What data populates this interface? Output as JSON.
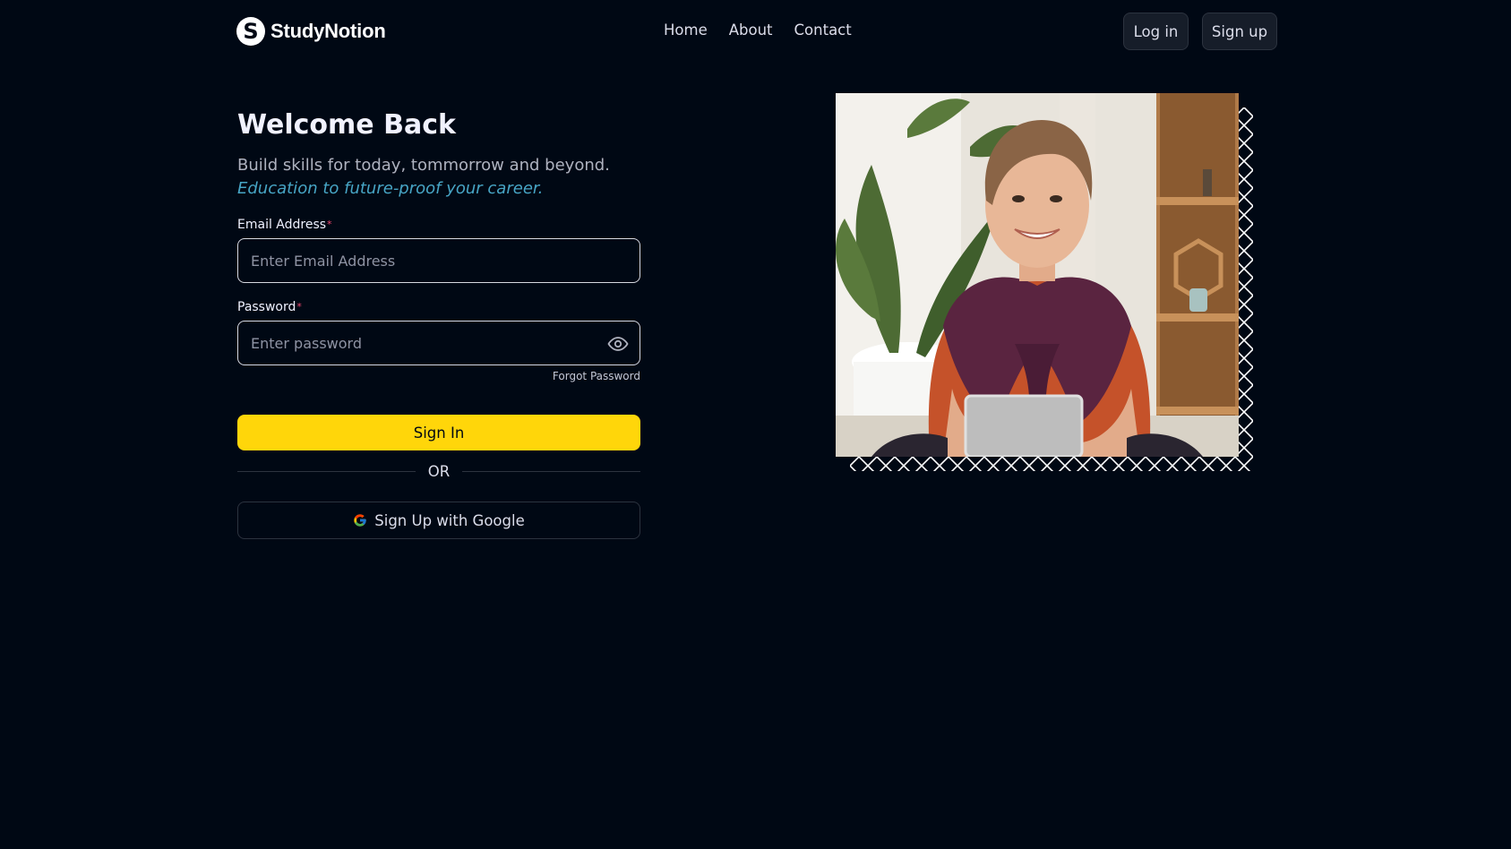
{
  "navbar": {
    "logo_mark": "S",
    "logo_text": "StudyNotion",
    "links": [
      {
        "label": "Home"
      },
      {
        "label": "About"
      },
      {
        "label": "Contact"
      }
    ],
    "login_label": "Log in",
    "signup_label": "Sign up"
  },
  "login": {
    "title": "Welcome Back",
    "subtitle": "Build skills for today, tommorrow and beyond.",
    "subtitle_emphasis": "Education to future-proof your career.",
    "email_label": "Email Address",
    "email_placeholder": "Enter Email Address",
    "email_value": "",
    "password_label": "Password",
    "password_placeholder": "Enter password",
    "password_value": "",
    "required_mark": "*",
    "forgot_label": "Forgot Password",
    "signin_label": "Sign In",
    "or_label": "OR",
    "google_label": "Sign Up with Google"
  },
  "colors": {
    "background": "#000814",
    "accent_yellow": "#ffd60a",
    "accent_blue": "#47a5c5",
    "required_red": "#ef476f"
  },
  "icons": {
    "logo": "studynotion-logo-icon",
    "password_toggle": "eye-icon",
    "google": "google-icon"
  }
}
